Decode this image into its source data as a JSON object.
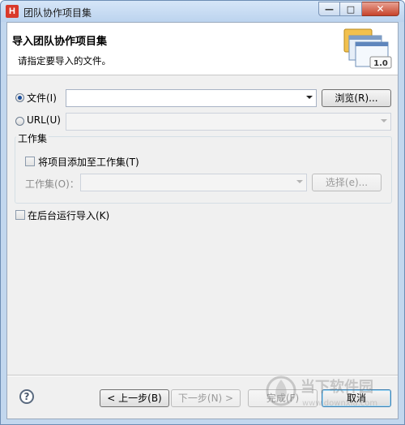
{
  "window": {
    "title": "团队协作项目集",
    "app_icon_letter": "H",
    "controls": {
      "minimize": "—",
      "maximize": "□",
      "close": "✕"
    }
  },
  "banner": {
    "title": "导入团队协作项目集",
    "description": "请指定要导入的文件。",
    "image_version": "1.0"
  },
  "source": {
    "file_option": {
      "label": "文件(I)",
      "selected": true
    },
    "file_value": "",
    "browse_label": "浏览(R)...",
    "url_option": {
      "label": "URL(U)",
      "selected": false
    },
    "url_value": ""
  },
  "working_set": {
    "group_title": "工作集",
    "add_checkbox_label": "将项目添加至工作集(T)",
    "add_checked": false,
    "field_label": "工作集(O)：",
    "field_value": "",
    "select_label": "选择(e)..."
  },
  "background_checkbox": {
    "label": "在后台运行导入(K)",
    "checked": false
  },
  "footer": {
    "help_glyph": "?",
    "back_label": "< 上一步(B)",
    "next_label": "下一步(N) >",
    "finish_label": "完成(F)",
    "cancel_label": "取消"
  },
  "watermark": {
    "text": "当下软件园",
    "url": "www.downxia.com"
  },
  "colors": {
    "title_bar": "#c2d7ee",
    "close_button": "#c7432b",
    "radio_dot": "#1b4e9c"
  }
}
